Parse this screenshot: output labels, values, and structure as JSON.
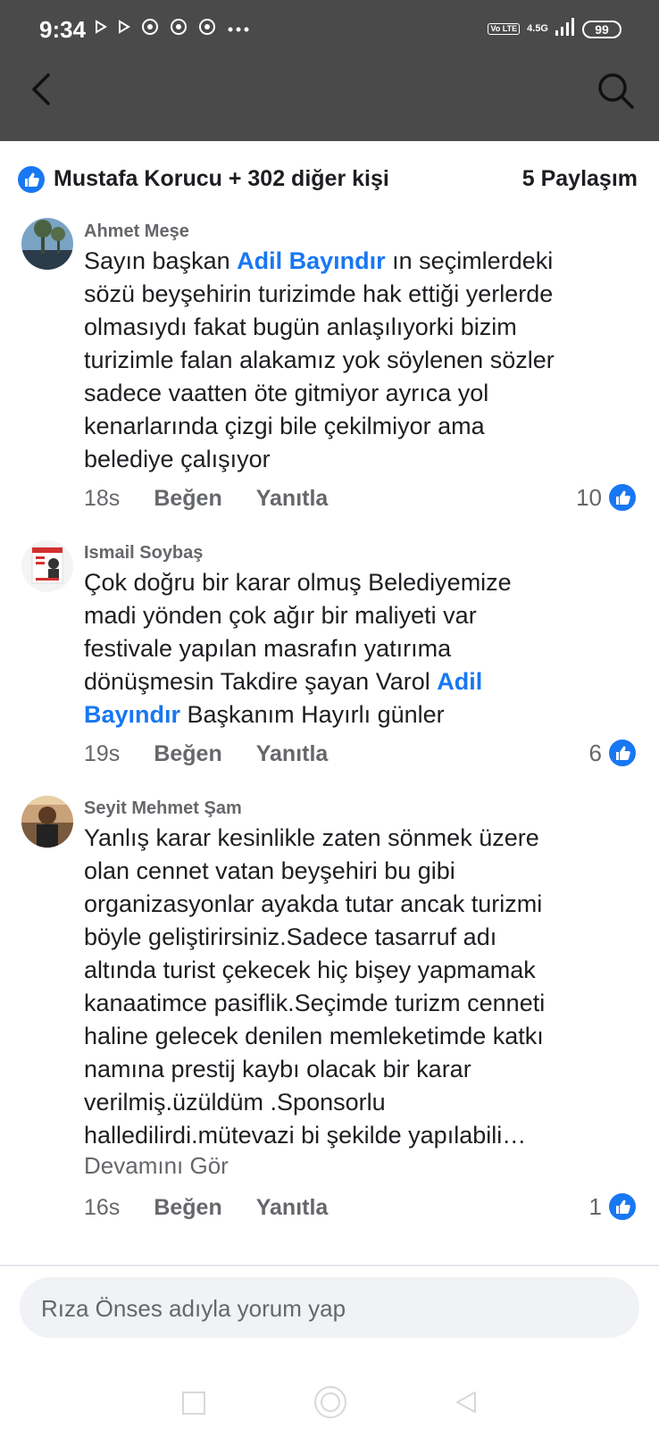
{
  "status_bar": {
    "time": "9:34",
    "volte": "Vo LTE",
    "network": "4.5G",
    "battery": "99",
    "icons": [
      "play-icon",
      "play-icon",
      "chrome-icon",
      "chrome-icon",
      "chrome-icon",
      "more-dots-icon"
    ]
  },
  "app_bar": {
    "back_icon": "chevron-left-icon",
    "search_icon": "search-icon"
  },
  "reactions": {
    "summary": "Mustafa Korucu + 302 diğer kişi",
    "shares": "5 Paylaşım"
  },
  "comments": [
    {
      "author": "Ahmet Meşe",
      "text_before": "Sayın başkan ",
      "mention": "Adil Bayındır",
      "text_after": " ın seçimlerdeki\nsözü beyşehirin turizimde hak ettiği yerlerde\nolmasıydı fakat bugün anlaşılıyorki bizim\nturizimle falan alakamız yok söylenen sözler\nsadece vaatten öte gitmiyor ayrıca yol\nkenarlarında çizgi bile çekilmiyor ama\nbelediye çalışıyor",
      "time": "18s",
      "like_label": "Beğen",
      "reply_label": "Yanıtla",
      "likes": "10"
    },
    {
      "author": "Ismail Soybaş",
      "text_before": "Çok doğru bir karar olmuş Belediyemize\nmadi yönden çok ağır bir maliyeti var\nfestivale yapılan masrafın yatırıma\ndönüşmesin Takdire şayan Varol ",
      "mention": "Adil\nBayındır",
      "text_after": " Başkanım Hayırlı günler",
      "time": "19s",
      "like_label": "Beğen",
      "reply_label": "Yanıtla",
      "likes": "6"
    },
    {
      "author": "Seyit Mehmet Şam",
      "text": "Yanlış karar kesinlikle zaten sönmek üzere\nolan cennet vatan beyşehiri bu gibi\norganizasyonlar ayakda tutar ancak turizmi\nböyle geliştirirsiniz.Sadece tasarruf adı\naltında turist çekecek hiç bişey yapmamak\nkanaatimce pasiflik.Seçimde turizm cenneti\nhaline gelecek denilen memleketimde katkı\nnamına prestij kaybı olacak bir karar\nverilmiş.üzüldüm .Sponsorlu\nhalledilirdi.mütevazi bi şekilde yapılabili…",
      "see_more": "Devamını Gör",
      "time": "16s",
      "like_label": "Beğen",
      "reply_label": "Yanıtla",
      "likes": "1"
    }
  ],
  "composer": {
    "placeholder": "Rıza Önses adıyla yorum yap"
  },
  "nav_bar": {
    "icons": [
      "recents-square-icon",
      "home-circle-icon",
      "back-triangle-icon"
    ]
  },
  "colors": {
    "bar": "#4a4a4a",
    "accent": "#1877f2",
    "meta": "#65676b"
  }
}
